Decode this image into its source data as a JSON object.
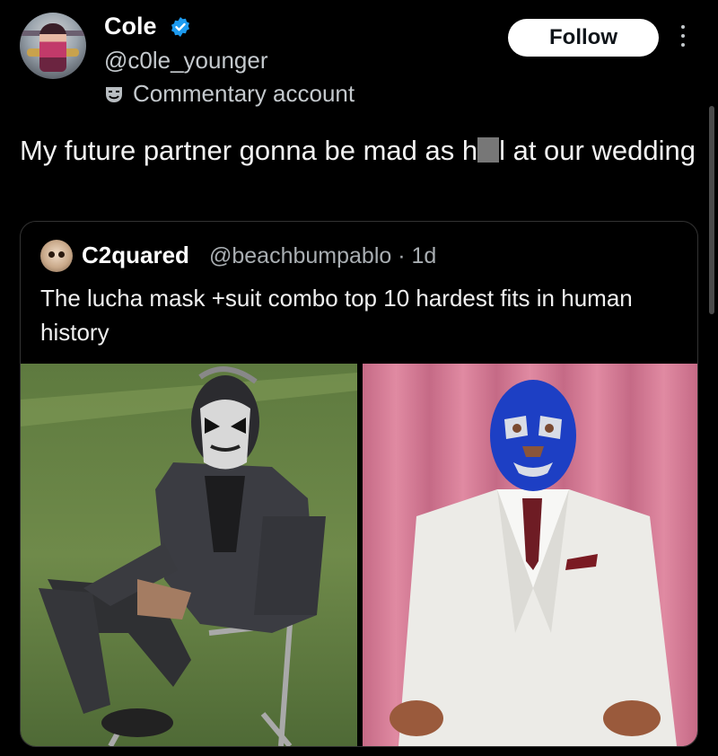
{
  "author": {
    "name": "Cole",
    "handle": "@c0le_younger",
    "label": "Commentary account"
  },
  "actions": {
    "follow_label": "Follow"
  },
  "tweet": {
    "text_before": "My future partner gonna be mad as h",
    "text_after": "l at our wedding"
  },
  "quote": {
    "author_name": "C2quared",
    "meta": "@beachbumpablo · 1d",
    "text": "The lucha mask +suit combo top 10 hardest fits in human history"
  },
  "colors": {
    "verified": "#1d9bf0",
    "background": "#000000",
    "text": "#e7e9ea",
    "secondary": "#c4c9cd"
  },
  "icons": [
    "verified-badge-icon",
    "theater-masks-icon",
    "more-options-icon"
  ]
}
